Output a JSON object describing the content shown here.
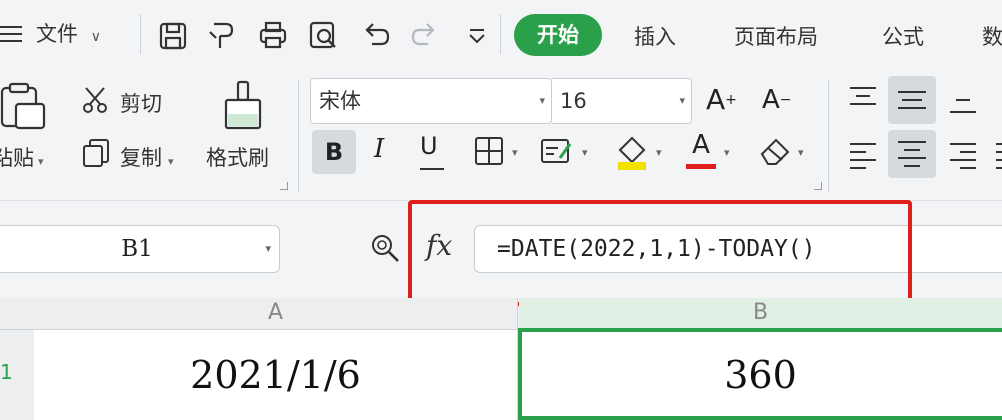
{
  "menubar": {
    "menu_label": "文件",
    "tabs": [
      "开始",
      "插入",
      "页面布局",
      "公式",
      "数"
    ],
    "quick_icons": [
      "save-icon",
      "format-painter-quick-icon",
      "print-icon",
      "print-preview-icon",
      "undo-icon",
      "redo-icon",
      "more-dropdown-icon"
    ]
  },
  "ribbon": {
    "paste_label": "粘贴",
    "cut_label": "剪切",
    "copy_label": "复制",
    "format_painter_label": "格式刷",
    "font_name": "宋体",
    "font_size": "16",
    "bold": "B",
    "italic": "I",
    "underline": "U",
    "font_color_accent": "#e01e1e",
    "highlight_accent": "#f2e200"
  },
  "formula_bar": {
    "name_box": "B1",
    "fx_label": "fx",
    "formula": "=DATE(2022,1,1)-TODAY()"
  },
  "sheet": {
    "columns": [
      "A",
      "B"
    ],
    "row_label": "1",
    "cells": {
      "A1": "2021/1/6",
      "B1": "360"
    },
    "selection_color": "#2aa04a"
  }
}
